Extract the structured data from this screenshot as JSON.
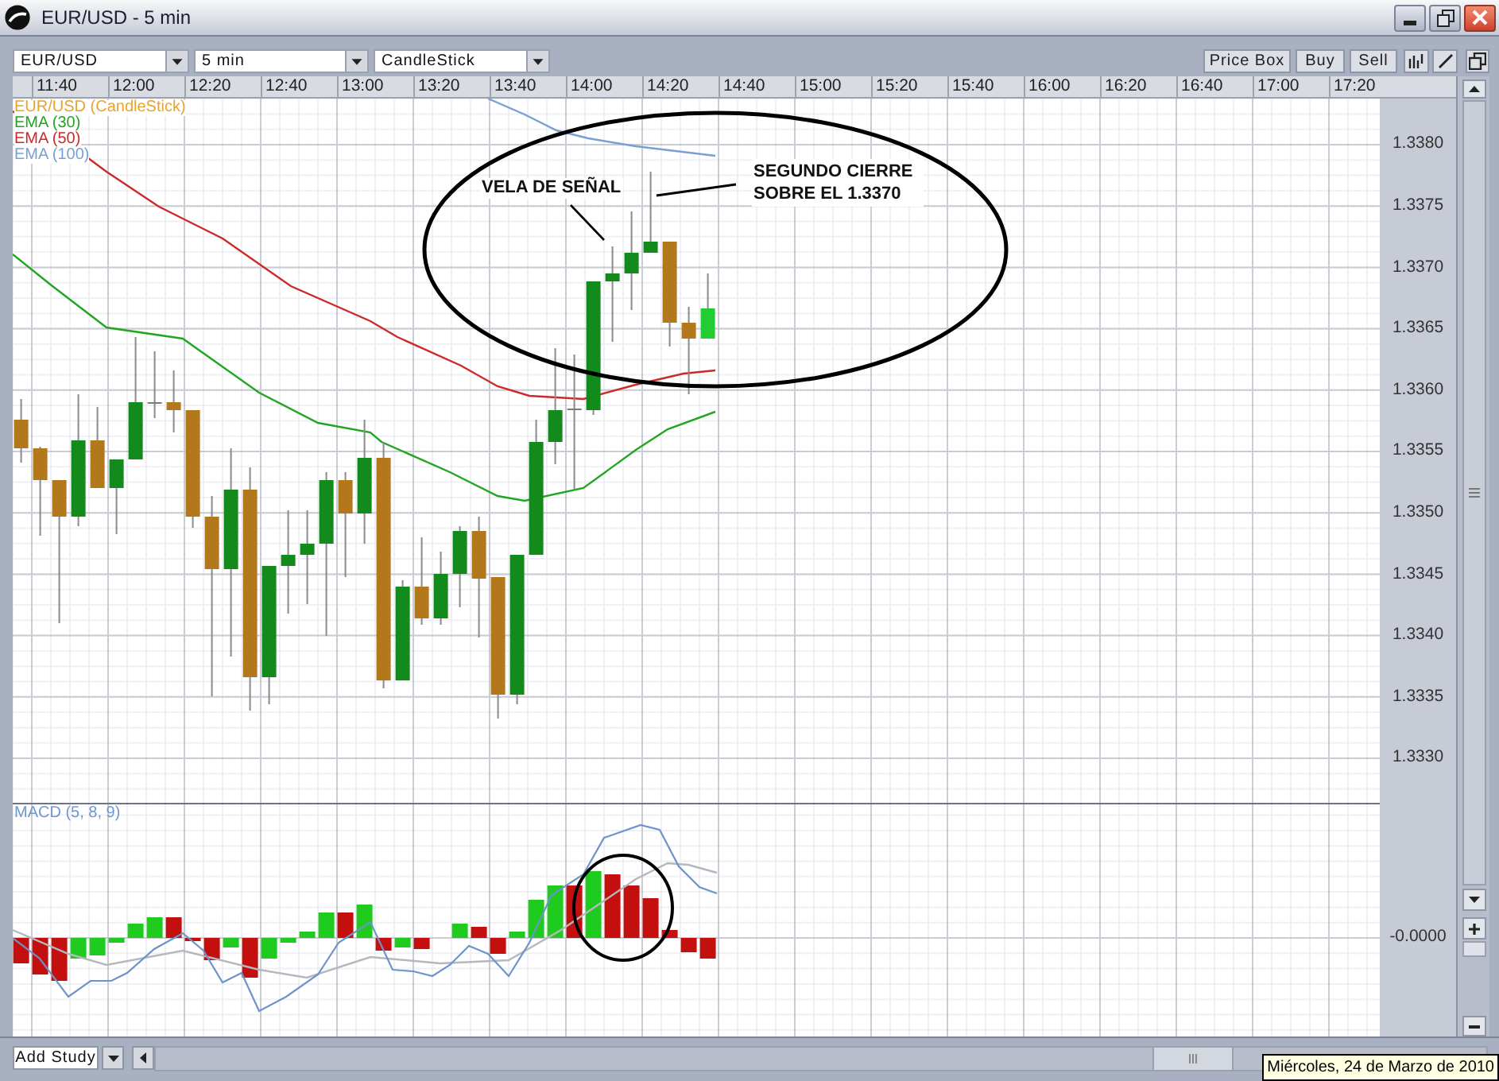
{
  "window": {
    "title": "EUR/USD - 5 min"
  },
  "toolbar": {
    "dropdowns": [
      {
        "value": "EUR/USD"
      },
      {
        "value": "5 min"
      },
      {
        "value": "CandleStick"
      }
    ],
    "buttons": [
      {
        "label": "Price Box"
      },
      {
        "label": "Buy"
      },
      {
        "label": "Sell"
      }
    ]
  },
  "time_axis": {
    "labels": [
      "11:40",
      "12:00",
      "12:20",
      "12:40",
      "13:00",
      "13:20",
      "13:40",
      "14:00",
      "14:20",
      "14:40",
      "15:00",
      "15:20",
      "15:40",
      "16:00",
      "16:20",
      "16:40",
      "17:00",
      "17:20"
    ]
  },
  "price_chart": {
    "legend": [
      {
        "label": "EUR/USD (CandleStick)",
        "color": "#e8a32a"
      },
      {
        "label": "EMA (30)",
        "color": "#22a622"
      },
      {
        "label": "EMA (50)",
        "color": "#cc2a2a"
      },
      {
        "label": "EMA (100)",
        "color": "#7a9fd4"
      }
    ],
    "price_labels": [
      "1.3380",
      "1.3375",
      "1.3370",
      "1.3365",
      "1.3360",
      "1.3355",
      "1.3350",
      "1.3345",
      "1.3340",
      "1.3335",
      "1.3330"
    ],
    "annotations": [
      {
        "text": "VELA DE SEÑAL"
      },
      {
        "text": "SEGUNDO CIERRE SOBRE EL 1.3370"
      }
    ]
  },
  "macd_panel": {
    "label": "MACD (5, 8, 9)",
    "axis_label": "-0.0000"
  },
  "bottom_bar": {
    "add_study": "Add Study"
  },
  "tooltip": {
    "text": "Miércoles, 24 de Marzo de 2010"
  }
}
